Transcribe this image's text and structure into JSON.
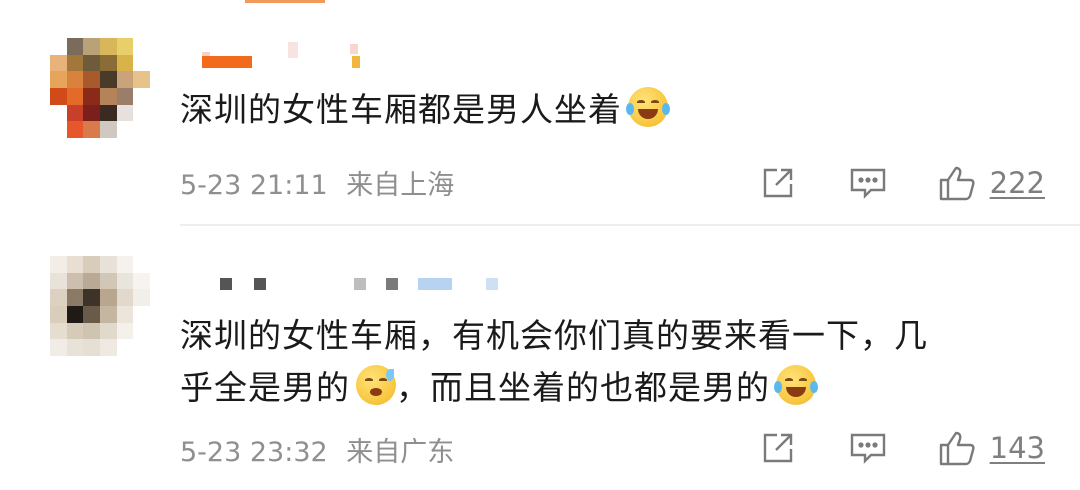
{
  "comments": [
    {
      "text": "深圳的女性车厢都是男人坐着",
      "emoji": "laughing-tears-emoji",
      "date": "5-23 21:11",
      "location": "来自上海",
      "likes": "222"
    },
    {
      "text_line1": "深圳的女性车厢，有机会你们真的要来看一下，几",
      "text_line2a": "乎全是男的",
      "emoji_a": "sleepy-sweat-emoji",
      "text_line2b": "，而且坐着的也都是男的",
      "emoji_b": "crying-laughing-emoji",
      "date": "5-23 23:32",
      "location": "来自广东",
      "likes": "143"
    }
  ],
  "icons": {
    "share": "share-icon",
    "comment": "comment-icon",
    "like": "thumbs-up-icon"
  },
  "colors": {
    "meta_text": "#8f8f8f",
    "body_text": "#1a1a1a",
    "icon": "#7a7a7a"
  }
}
